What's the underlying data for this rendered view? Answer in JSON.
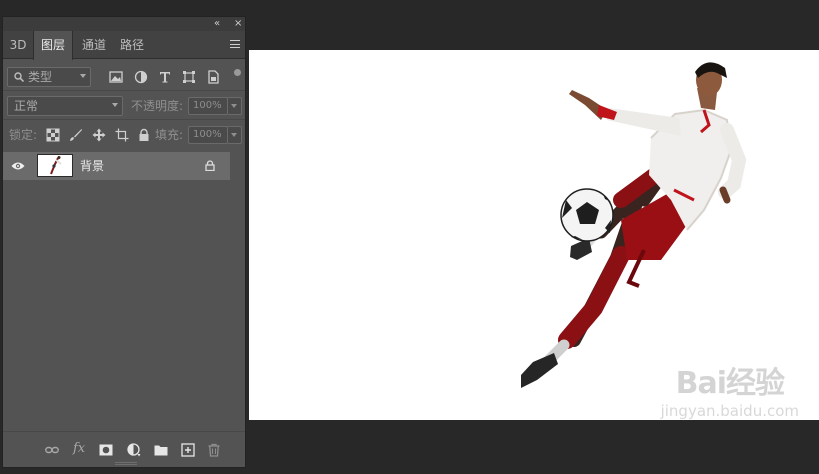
{
  "panel": {
    "collapse_glyph": "«",
    "close_glyph": "×",
    "tabs": [
      {
        "label": "3D",
        "active": false
      },
      {
        "label": "图层",
        "active": true
      },
      {
        "label": "通道",
        "active": false
      },
      {
        "label": "路径",
        "active": false
      }
    ],
    "filter": {
      "kind_label": "类型",
      "icons": [
        "image-filter-icon",
        "adjustment-filter-icon",
        "type-filter-icon",
        "shape-filter-icon",
        "smart-object-filter-icon"
      ]
    },
    "blend": {
      "mode": "正常",
      "opacity_label": "不透明度:",
      "opacity_value": "100%"
    },
    "lock": {
      "label": "锁定:",
      "fill_label": "填充:",
      "fill_value": "100%"
    },
    "layers": [
      {
        "name": "背景",
        "visible": true,
        "locked": true
      }
    ],
    "footer_icons": [
      "link-layers-icon",
      "fx-icon",
      "add-mask-icon",
      "adjustment-layer-icon",
      "new-group-icon",
      "new-layer-icon",
      "trash-icon"
    ],
    "footer_fx_label": "fx"
  },
  "canvas": {
    "background_color": "#ffffff",
    "image_subject": "soccer player kicking a ball",
    "watermark": {
      "logo": "Bai经验",
      "url": "jingyan.baidu.com"
    }
  },
  "colors": {
    "app_bg": "#282828",
    "panel_bg": "#535353",
    "selected_layer": "#6b6b6b"
  }
}
